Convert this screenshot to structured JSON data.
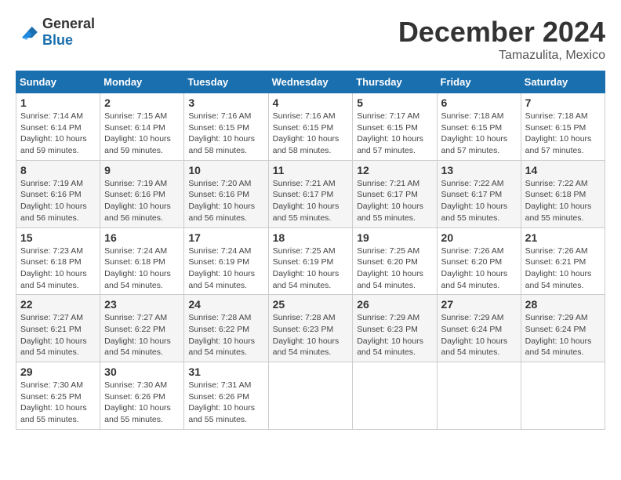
{
  "logo": {
    "general": "General",
    "blue": "Blue"
  },
  "title": "December 2024",
  "location": "Tamazulita, Mexico",
  "days_header": [
    "Sunday",
    "Monday",
    "Tuesday",
    "Wednesday",
    "Thursday",
    "Friday",
    "Saturday"
  ],
  "weeks": [
    [
      {
        "day": "1",
        "sunrise": "7:14 AM",
        "sunset": "6:14 PM",
        "daylight": "10 hours and 59 minutes."
      },
      {
        "day": "2",
        "sunrise": "7:15 AM",
        "sunset": "6:14 PM",
        "daylight": "10 hours and 59 minutes."
      },
      {
        "day": "3",
        "sunrise": "7:16 AM",
        "sunset": "6:15 PM",
        "daylight": "10 hours and 58 minutes."
      },
      {
        "day": "4",
        "sunrise": "7:16 AM",
        "sunset": "6:15 PM",
        "daylight": "10 hours and 58 minutes."
      },
      {
        "day": "5",
        "sunrise": "7:17 AM",
        "sunset": "6:15 PM",
        "daylight": "10 hours and 57 minutes."
      },
      {
        "day": "6",
        "sunrise": "7:18 AM",
        "sunset": "6:15 PM",
        "daylight": "10 hours and 57 minutes."
      },
      {
        "day": "7",
        "sunrise": "7:18 AM",
        "sunset": "6:15 PM",
        "daylight": "10 hours and 57 minutes."
      }
    ],
    [
      {
        "day": "8",
        "sunrise": "7:19 AM",
        "sunset": "6:16 PM",
        "daylight": "10 hours and 56 minutes."
      },
      {
        "day": "9",
        "sunrise": "7:19 AM",
        "sunset": "6:16 PM",
        "daylight": "10 hours and 56 minutes."
      },
      {
        "day": "10",
        "sunrise": "7:20 AM",
        "sunset": "6:16 PM",
        "daylight": "10 hours and 56 minutes."
      },
      {
        "day": "11",
        "sunrise": "7:21 AM",
        "sunset": "6:17 PM",
        "daylight": "10 hours and 55 minutes."
      },
      {
        "day": "12",
        "sunrise": "7:21 AM",
        "sunset": "6:17 PM",
        "daylight": "10 hours and 55 minutes."
      },
      {
        "day": "13",
        "sunrise": "7:22 AM",
        "sunset": "6:17 PM",
        "daylight": "10 hours and 55 minutes."
      },
      {
        "day": "14",
        "sunrise": "7:22 AM",
        "sunset": "6:18 PM",
        "daylight": "10 hours and 55 minutes."
      }
    ],
    [
      {
        "day": "15",
        "sunrise": "7:23 AM",
        "sunset": "6:18 PM",
        "daylight": "10 hours and 54 minutes."
      },
      {
        "day": "16",
        "sunrise": "7:24 AM",
        "sunset": "6:18 PM",
        "daylight": "10 hours and 54 minutes."
      },
      {
        "day": "17",
        "sunrise": "7:24 AM",
        "sunset": "6:19 PM",
        "daylight": "10 hours and 54 minutes."
      },
      {
        "day": "18",
        "sunrise": "7:25 AM",
        "sunset": "6:19 PM",
        "daylight": "10 hours and 54 minutes."
      },
      {
        "day": "19",
        "sunrise": "7:25 AM",
        "sunset": "6:20 PM",
        "daylight": "10 hours and 54 minutes."
      },
      {
        "day": "20",
        "sunrise": "7:26 AM",
        "sunset": "6:20 PM",
        "daylight": "10 hours and 54 minutes."
      },
      {
        "day": "21",
        "sunrise": "7:26 AM",
        "sunset": "6:21 PM",
        "daylight": "10 hours and 54 minutes."
      }
    ],
    [
      {
        "day": "22",
        "sunrise": "7:27 AM",
        "sunset": "6:21 PM",
        "daylight": "10 hours and 54 minutes."
      },
      {
        "day": "23",
        "sunrise": "7:27 AM",
        "sunset": "6:22 PM",
        "daylight": "10 hours and 54 minutes."
      },
      {
        "day": "24",
        "sunrise": "7:28 AM",
        "sunset": "6:22 PM",
        "daylight": "10 hours and 54 minutes."
      },
      {
        "day": "25",
        "sunrise": "7:28 AM",
        "sunset": "6:23 PM",
        "daylight": "10 hours and 54 minutes."
      },
      {
        "day": "26",
        "sunrise": "7:29 AM",
        "sunset": "6:23 PM",
        "daylight": "10 hours and 54 minutes."
      },
      {
        "day": "27",
        "sunrise": "7:29 AM",
        "sunset": "6:24 PM",
        "daylight": "10 hours and 54 minutes."
      },
      {
        "day": "28",
        "sunrise": "7:29 AM",
        "sunset": "6:24 PM",
        "daylight": "10 hours and 54 minutes."
      }
    ],
    [
      {
        "day": "29",
        "sunrise": "7:30 AM",
        "sunset": "6:25 PM",
        "daylight": "10 hours and 55 minutes."
      },
      {
        "day": "30",
        "sunrise": "7:30 AM",
        "sunset": "6:26 PM",
        "daylight": "10 hours and 55 minutes."
      },
      {
        "day": "31",
        "sunrise": "7:31 AM",
        "sunset": "6:26 PM",
        "daylight": "10 hours and 55 minutes."
      },
      null,
      null,
      null,
      null
    ]
  ],
  "labels": {
    "sunrise": "Sunrise:",
    "sunset": "Sunset:",
    "daylight": "Daylight:"
  }
}
